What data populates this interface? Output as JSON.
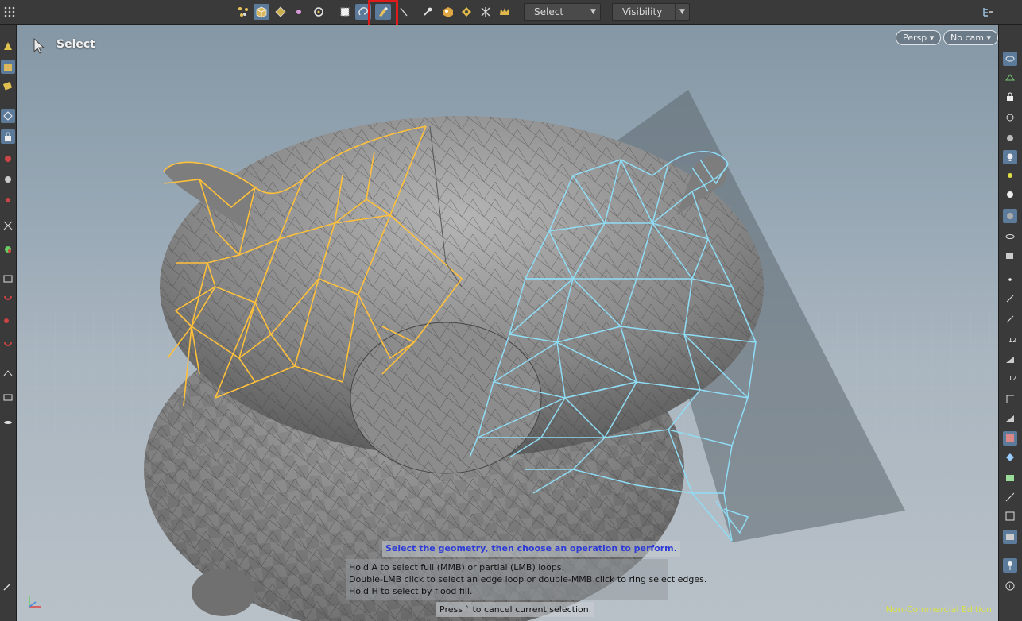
{
  "toolbar": {
    "select_dropdown": "Select",
    "visibility_dropdown": "Visibility"
  },
  "viewport": {
    "tool_label": "Select",
    "camera_persp": "Persp",
    "camera_cam": "No cam",
    "hint_title": "Select the geometry, then choose an operation to perform.",
    "hint_lines": [
      "Hold A to select full (MMB) or partial (LMB) loops.",
      "Double-LMB click to select an edge loop or double-MMB click to ring select edges.",
      "Hold H to select by flood fill."
    ],
    "hint_cancel": "Press ` to cancel current selection.",
    "edition": "Non-Commercial Edition"
  },
  "colors": {
    "selection_left": "#ffc03a",
    "selection_right": "#8fdcf5",
    "highlight": "#e01b1b",
    "active_button": "#5c7a9a"
  },
  "icons": {
    "toolbar": [
      "grid-menu-icon",
      "points-select-icon",
      "primitive-select-icon",
      "vertex-select-icon",
      "dot-icon",
      "circle-select-icon",
      "box-select-icon",
      "lasso-select-icon",
      "paint-select-icon",
      "laser-select-icon",
      "select-groups-icon",
      "select-visible-icon",
      "select-hidden-icon",
      "select-edges-icon",
      "select-all-icon",
      "display-options-icon"
    ]
  }
}
